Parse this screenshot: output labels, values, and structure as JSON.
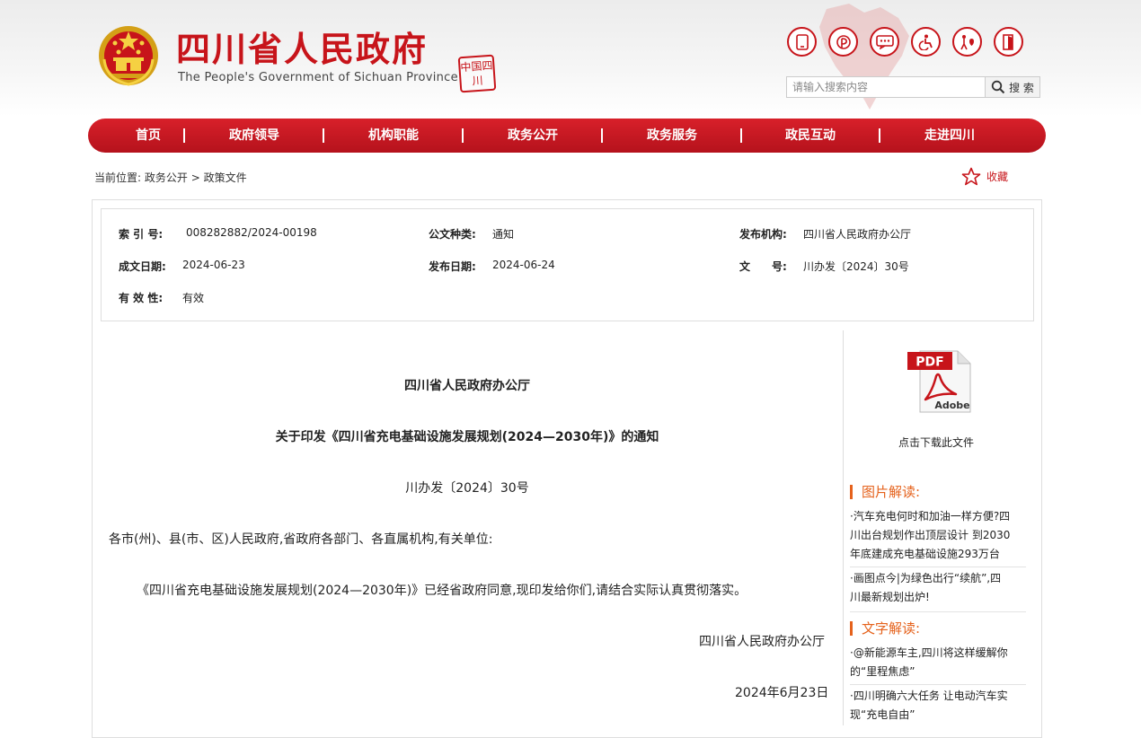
{
  "site": {
    "title": "四川省人民政府",
    "subtitle": "The People's Government of Sichuan Province",
    "seal_text": "中国四川"
  },
  "toolbar_icons": [
    "mobile-icon",
    "weibo-icon",
    "message-icon",
    "accessibility-icon",
    "elderly-care-icon",
    "exit-icon"
  ],
  "search": {
    "placeholder": "请输入搜索内容",
    "button_label": "搜 索"
  },
  "nav": {
    "items": [
      "首页",
      "政府领导",
      "机构职能",
      "政务公开",
      "政务服务",
      "政民互动",
      "走进四川"
    ]
  },
  "breadcrumb": {
    "prefix": "当前位置:",
    "level1": "政务公开",
    "separator": ">",
    "level2": "政策文件"
  },
  "favorite_label": "收藏",
  "meta": {
    "index_no_label": "索 引 号:",
    "index_no": "008282882/2024-00198",
    "doc_type_label": "公文种类:",
    "doc_type": "通知",
    "publisher_label": "发布机构:",
    "publisher": "四川省人民政府办公厅",
    "written_date_label": "成文日期:",
    "written_date": "2024-06-23",
    "publish_date_label": "发布日期:",
    "publish_date": "2024-06-24",
    "doc_no_label": "文　　号:",
    "doc_no": "川办发〔2024〕30号",
    "validity_label": "有 效 性:",
    "validity": "有效"
  },
  "document": {
    "issuer": "四川省人民政府办公厅",
    "title": "关于印发《四川省充电基础设施发展规划(2024—2030年)》的通知",
    "doc_number": "川办发〔2024〕30号",
    "recipients": "各市(州)、县(市、区)人民政府,省政府各部门、各直属机构,有关单位:",
    "body": "《四川省充电基础设施发展规划(2024—2030年)》已经省政府同意,现印发给你们,请结合实际认真贯彻落实。",
    "signature": "四川省人民政府办公厅",
    "date": "2024年6月23日"
  },
  "sidebar": {
    "pdf_label": "PDF",
    "pdf_brand": "Adobe",
    "download_label": "点击下载此文件",
    "picture_section_title": "图片解读:",
    "picture_items": [
      {
        "line1": "·汽车充电何时和加油一样方便?四",
        "line2": "川出台规划作出顶层设计 到2030",
        "line3": "年底建成充电基础设施293万台"
      },
      {
        "line1": "·画图点今|为绿色出行“续航”,四",
        "line2": "川最新规划出炉!"
      }
    ],
    "text_section_title": "文字解读:",
    "text_items": [
      {
        "line1": "·@新能源车主,四川将这样缓解你",
        "line2": "的“里程焦虑”"
      },
      {
        "line1": "·四川明确六大任务 让电动汽车实",
        "line2": "现“充电自由”"
      }
    ]
  },
  "colors": {
    "brand_red": "#c7141a",
    "accent_orange": "#e5621c"
  }
}
